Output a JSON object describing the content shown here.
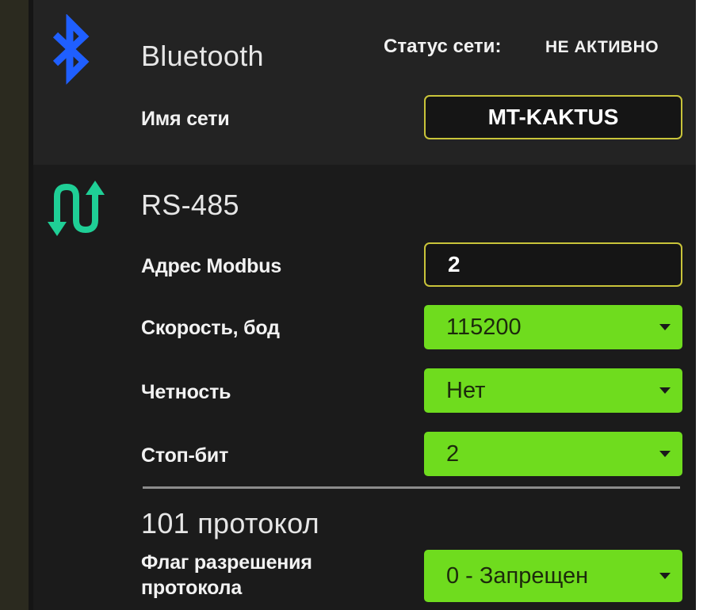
{
  "bluetooth": {
    "title": "Bluetooth",
    "status_label": "Статус сети:",
    "status_value": "НЕ АКТИВНО",
    "network_name_label": "Имя сети",
    "network_name_value": "MT-KAKTUS",
    "icon": "bluetooth-icon",
    "icon_color": "#1f5fff"
  },
  "rs485": {
    "title": "RS-485",
    "icon": "swap-arrows-icon",
    "icon_color": "#1fcf96",
    "modbus_label": "Адрес Modbus",
    "modbus_value": "2",
    "baud_label": "Скорость, бод",
    "baud_value": "115200",
    "parity_label": "Четность",
    "parity_value": "Нет",
    "stopbits_label": "Стоп-бит",
    "stopbits_value": "2"
  },
  "protocol101": {
    "title": "101 протокол",
    "flag_label_line1": "Флаг разрешения",
    "flag_label_line2": "протокола",
    "flag_value": "0 - Запрещен"
  },
  "colors": {
    "accent_green": "#6fdc1e",
    "field_border": "#c9c43a",
    "panel_bg": "#1c1c1c"
  }
}
